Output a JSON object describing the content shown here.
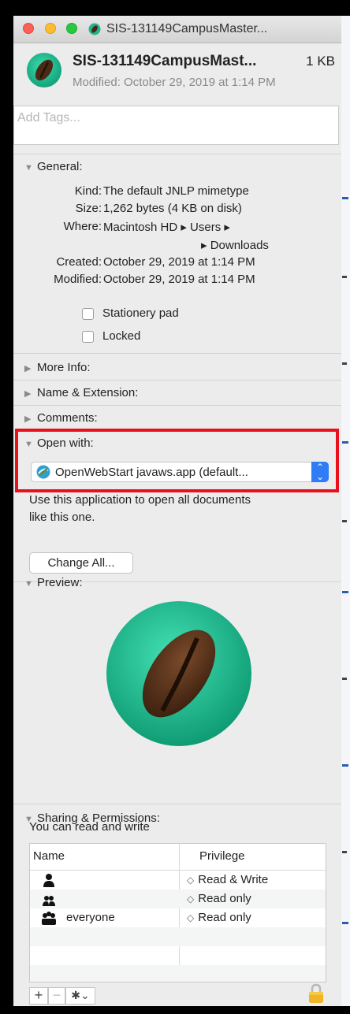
{
  "window": {
    "title": "SIS-131149CampusMaster..."
  },
  "header": {
    "file_name": "SIS-131149CampusMast...",
    "file_size": "1 KB",
    "modified": "Modified: October 29, 2019 at 1:14 PM"
  },
  "tags": {
    "placeholder": "Add Tags..."
  },
  "general": {
    "label": "General:",
    "rows": [
      {
        "key": "Kind:",
        "value": "The default JNLP mimetype"
      },
      {
        "key": "Size:",
        "value": "1,262 bytes (4 KB on disk)"
      },
      {
        "key": "Where:",
        "value": "Macintosh HD ▸ Users ▸"
      },
      {
        "key": "",
        "value": "▸ Downloads"
      },
      {
        "key": "Created:",
        "value": "October 29, 2019 at 1:14 PM"
      },
      {
        "key": "Modified:",
        "value": "October 29, 2019 at 1:14 PM"
      }
    ],
    "stationery_label": "Stationery pad",
    "stationery_checked": false,
    "locked_label": "Locked",
    "locked_checked": false
  },
  "sections": {
    "more_info": "More Info:",
    "name_ext": "Name & Extension:",
    "comments": "Comments:",
    "open_with": "Open with:",
    "preview": "Preview:",
    "sharing": "Sharing & Permissions:"
  },
  "open_with": {
    "selected_app": "OpenWebStart javaws.app (default...",
    "description_line1": "Use this application to open all documents",
    "description_line2": "like this one.",
    "change_all_label": "Change All..."
  },
  "sharing": {
    "summary": "You can read and write",
    "columns": [
      "Name",
      "Privilege"
    ],
    "rows": [
      {
        "user": "",
        "icon": "single-user-icon",
        "privilege": "Read & Write"
      },
      {
        "user": "",
        "icon": "group-icon",
        "privilege": "Read only"
      },
      {
        "user": "everyone",
        "icon": "everyone-icon",
        "privilege": "Read only"
      }
    ],
    "add_label": "+",
    "remove_label": "−",
    "action_label": "✱⌄"
  },
  "colors": {
    "highlight_border": "#e8101b",
    "popup_accent": "#2e7cf6",
    "preview_teal": "#1fb58f"
  }
}
